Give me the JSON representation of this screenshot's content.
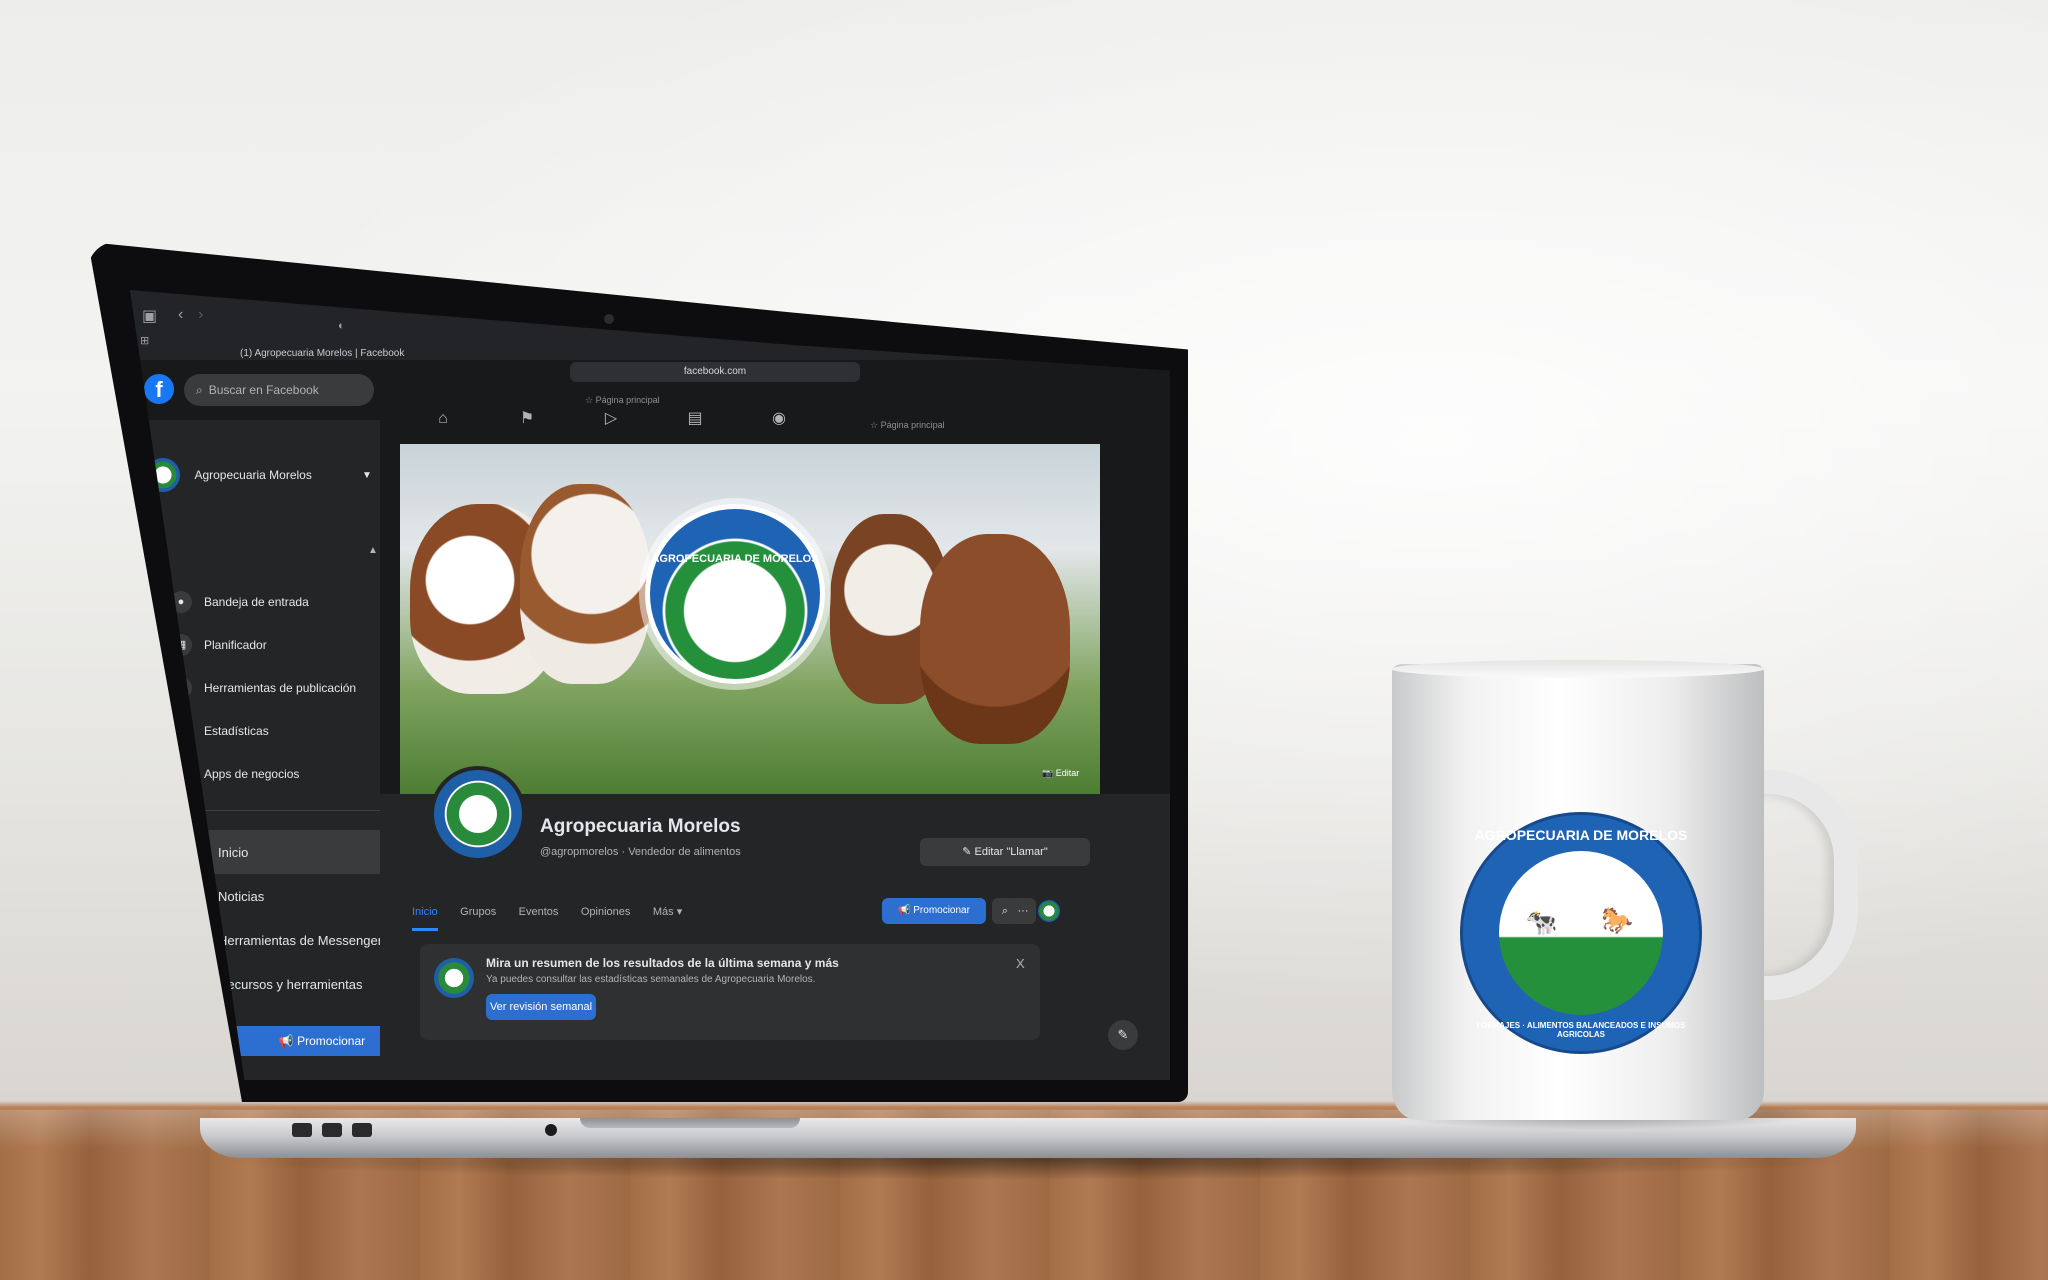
{
  "browser": {
    "tab_title": "(1) Agropecuaria Morelos | Facebook",
    "url": "facebook.com",
    "bookmark_1": "☆ Página principal",
    "bookmark_2": "☆ Página principal"
  },
  "header": {
    "logo": "f",
    "search_placeholder": "Buscar en Facebook",
    "notification_count": "1",
    "nav_icons": [
      "home-icon",
      "flag-icon",
      "video-icon",
      "marketplace-icon",
      "groups-icon"
    ]
  },
  "sidebar": {
    "page_name": "Agropecuaria Morelos",
    "tools": [
      {
        "label": "Bandeja de entrada",
        "icon": "chat-bubble-icon"
      },
      {
        "label": "Planificador",
        "icon": "calendar-icon"
      },
      {
        "label": "Herramientas de publicación",
        "icon": "publishing-tools-icon"
      },
      {
        "label": "Estadísticas",
        "icon": "stats-icon"
      },
      {
        "label": "Apps de negocios",
        "icon": "cube-icon"
      }
    ],
    "nav": [
      {
        "label": "Inicio",
        "icon": "home-icon",
        "active": true
      },
      {
        "label": "Noticias",
        "icon": "news-icon",
        "active": false
      },
      {
        "label": "Herramientas de Messenger",
        "icon": "messenger-icon",
        "active": false
      },
      {
        "label": "Recursos y herramientas",
        "icon": "info-icon",
        "active": false
      }
    ],
    "promote_label": "📢 Promocionar"
  },
  "cover": {
    "edit_label": "📷 Editar",
    "emblem_text": "AGROPECUARIA DE MORELOS"
  },
  "profile": {
    "name": "Agropecuaria Morelos",
    "handle": "@agropmorelos · Vendedor de alimentos",
    "edit_call_label": "✎ Editar \"Llamar\"",
    "tabs": [
      "Inicio",
      "Grupos",
      "Eventos",
      "Opiniones",
      "Más ▾"
    ],
    "promote_label": "📢 Promocionar"
  },
  "notice": {
    "title": "Mira un resumen de los resultados de la última semana y más",
    "body": "Ya puedes consultar las estadísticas semanales de Agropecuaria Morelos.",
    "button": "Ver revisión semanal",
    "close": "X"
  },
  "mug": {
    "logo_top": "AGROPECUARIA DE MORELOS",
    "logo_bottom": "FORRAJES · ALIMENTOS BALANCEADOS E INSUMOS AGRICOLAS"
  },
  "colors": {
    "fb_blue": "#1877f2",
    "brand_blue": "#1f63b5",
    "brand_green": "#24903c"
  }
}
